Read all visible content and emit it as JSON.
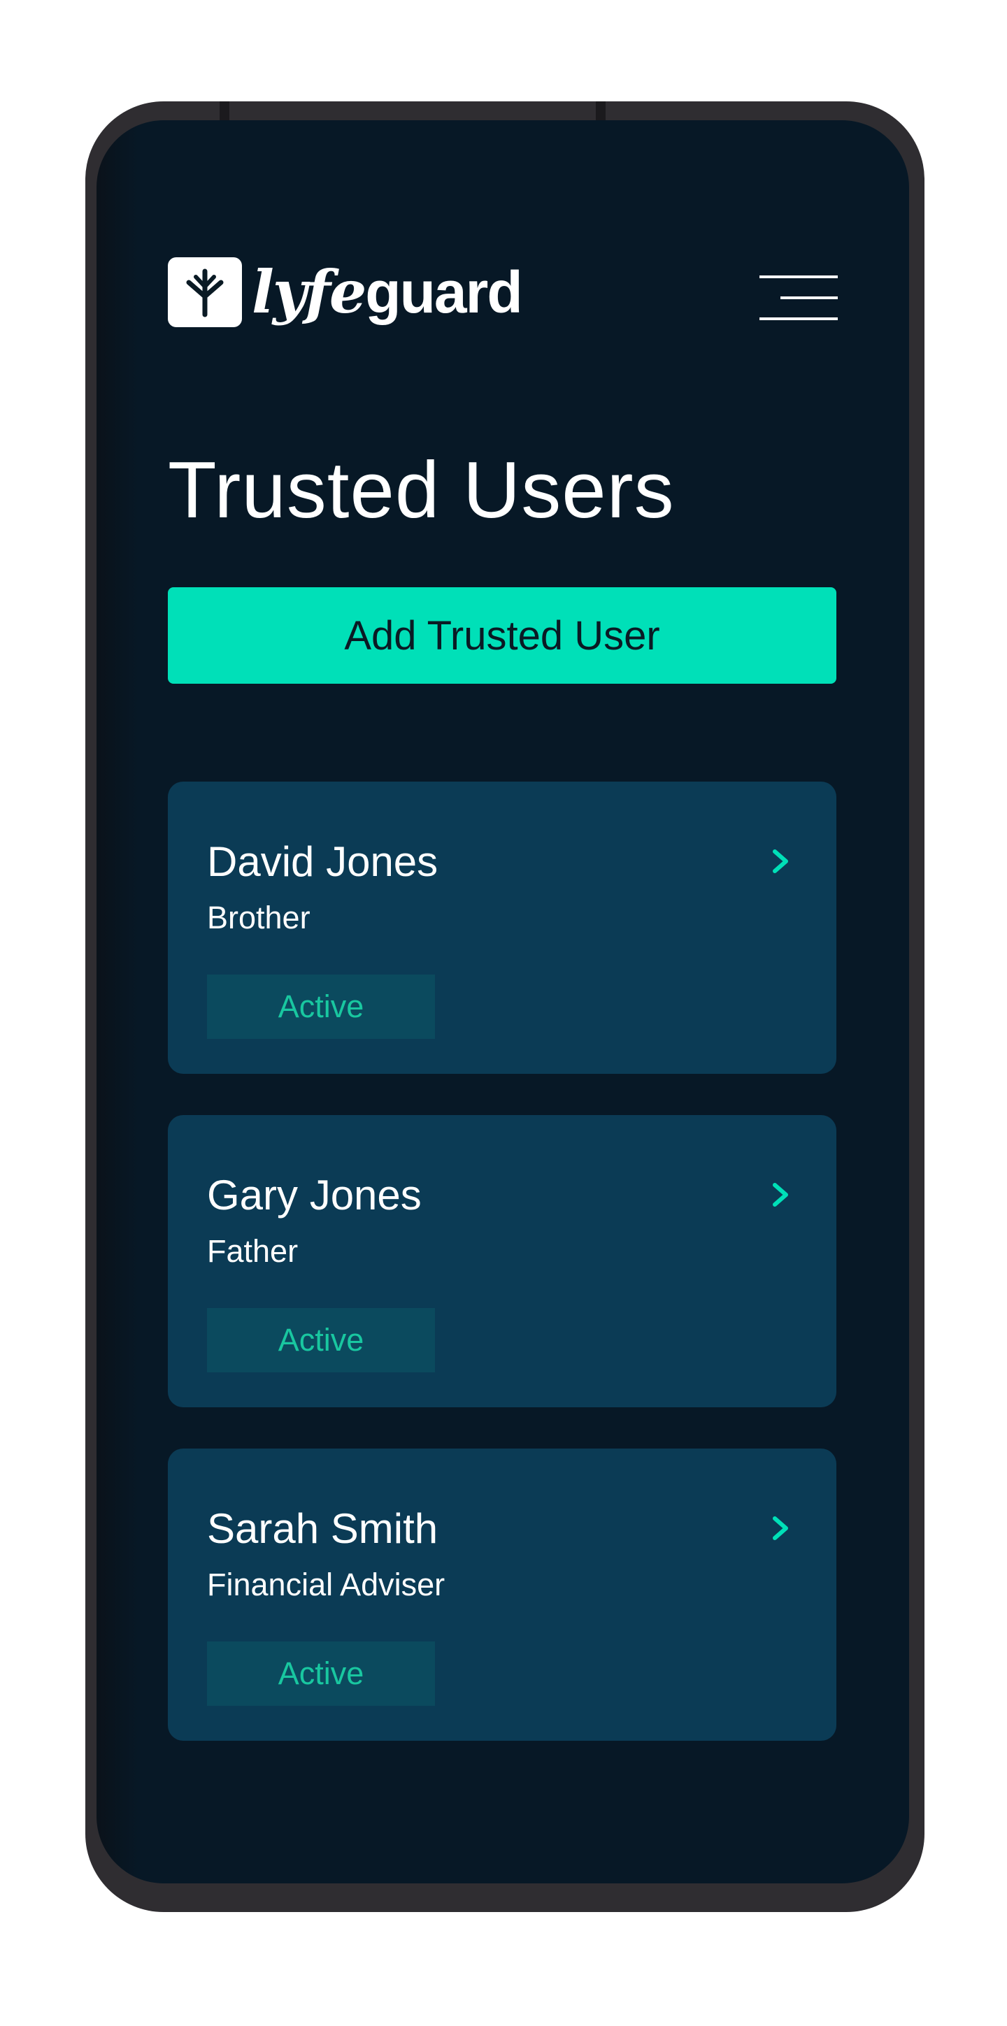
{
  "app": {
    "brand_prefix": "lyfe",
    "brand_suffix": "guard"
  },
  "header": {
    "menu_icon": "hamburger-menu-icon"
  },
  "page": {
    "title": "Trusted Users"
  },
  "actions": {
    "add_label": "Add Trusted User"
  },
  "trusted_users": [
    {
      "name": "David Jones",
      "relation": "Brother",
      "status": "Active"
    },
    {
      "name": "Gary Jones",
      "relation": "Father",
      "status": "Active"
    },
    {
      "name": "Sarah Smith",
      "relation": "Financial Adviser",
      "status": "Active"
    }
  ],
  "colors": {
    "screen_background": "#071826",
    "accent": "#00e0b8",
    "card_background": "#0b3b55",
    "badge_background": "#0b4a5e",
    "badge_text": "#19c7a0",
    "frame": "#2f2d31"
  }
}
